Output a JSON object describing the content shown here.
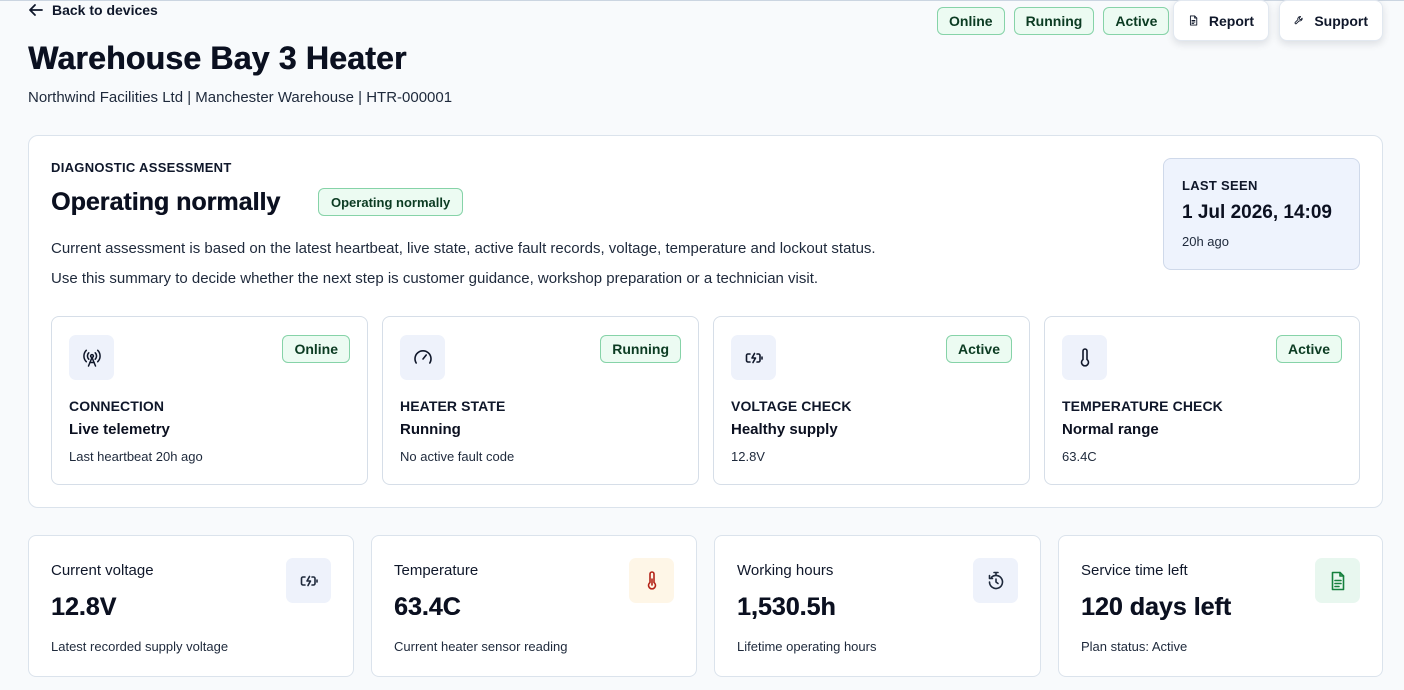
{
  "nav": {
    "back_label": "Back to devices"
  },
  "device": {
    "title": "Warehouse Bay 3 Heater",
    "subtitle": "Northwind Facilities Ltd | Manchester Warehouse | HTR-000001"
  },
  "status_pills": [
    "Online",
    "Running",
    "Active"
  ],
  "actions": {
    "report_label": "Report",
    "support_label": "Support"
  },
  "assessment": {
    "eyebrow": "DIAGNOSTIC ASSESSMENT",
    "title": "Operating normally",
    "badge": "Operating normally",
    "paragraph1": "Current assessment is based on the latest heartbeat, live state, active fault records, voltage, temperature and lockout status.",
    "paragraph2": "Use this summary to decide whether the next step is customer guidance, workshop preparation or a technician visit."
  },
  "last_seen": {
    "label": "LAST SEEN",
    "value": "1 Jul 2026, 14:09",
    "ago": "20h ago"
  },
  "checks": [
    {
      "icon": "antenna-icon",
      "badge": "Online",
      "label": "CONNECTION",
      "value": "Live telemetry",
      "detail": "Last heartbeat 20h ago"
    },
    {
      "icon": "gauge-icon",
      "badge": "Running",
      "label": "HEATER STATE",
      "value": "Running",
      "detail": "No active fault code"
    },
    {
      "icon": "battery-charging-icon",
      "badge": "Active",
      "label": "VOLTAGE CHECK",
      "value": "Healthy supply",
      "detail": "12.8V"
    },
    {
      "icon": "thermometer-icon",
      "badge": "Active",
      "label": "TEMPERATURE CHECK",
      "value": "Normal range",
      "detail": "63.4C"
    }
  ],
  "metrics": [
    {
      "label": "Current voltage",
      "value": "12.8V",
      "detail": "Latest recorded supply voltage",
      "icon": "battery-charging-icon",
      "icon_color": "#1e293b",
      "icon_bg": "#eef2fb"
    },
    {
      "label": "Temperature",
      "value": "63.4C",
      "detail": "Current heater sensor reading",
      "icon": "thermometer-icon",
      "icon_color": "#b42318",
      "icon_bg": "#fef6e7"
    },
    {
      "label": "Working hours",
      "value": "1,530.5h",
      "detail": "Lifetime operating hours",
      "icon": "timer-icon",
      "icon_color": "#1e293b",
      "icon_bg": "#eef2fb"
    },
    {
      "label": "Service time left",
      "value": "120 days left",
      "detail": "Plan status: Active",
      "icon": "document-icon",
      "icon_color": "#15803d",
      "icon_bg": "#e8f7ef"
    }
  ],
  "colors": {
    "pill_border": "#86d3a8",
    "pill_bg": "#ecfbf2",
    "last_seen_bg": "#eef3fd"
  }
}
